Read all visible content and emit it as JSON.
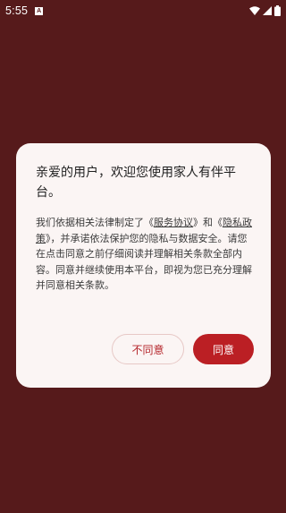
{
  "status_bar": {
    "time": "5:55",
    "notification_icon": "A",
    "icons": [
      "wifi-icon",
      "signal-icon",
      "battery-icon"
    ]
  },
  "dialog": {
    "title": "亲爱的用户，欢迎您使用家人有伴平台。",
    "body": {
      "part1": "我们依据相关法律制定了《",
      "link1": "服务协议",
      "part2": "》和《",
      "link2": "隐私政策",
      "part3": "》，并承诺依法保护您的隐私与数据安全。请您在点击同意之前仔细阅读并理解相关条款全部内容。同意并继续使用本平台，即视为您已充分理解并同意相关条款。"
    },
    "decline_label": "不同意",
    "agree_label": "同意"
  },
  "colors": {
    "background": "#561a1b",
    "dialog_bg": "#fbf5f4",
    "accent": "#bb1f24"
  }
}
